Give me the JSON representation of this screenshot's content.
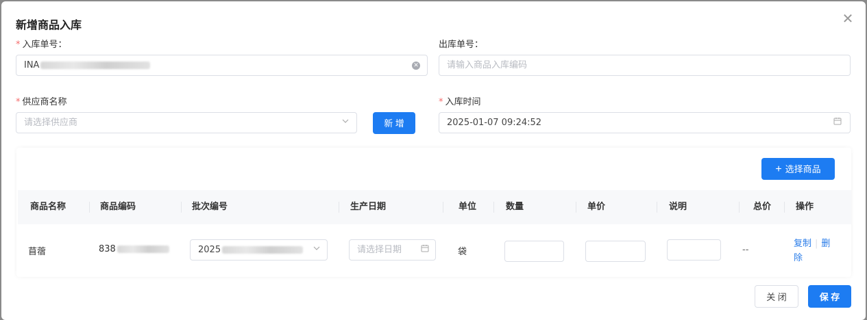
{
  "dialog": {
    "title": "新增商品入库",
    "close_icon": "close-icon"
  },
  "form": {
    "inbound_no": {
      "label": "入库单号：",
      "required": true,
      "value_prefix": "INA"
    },
    "outbound_no": {
      "label": "出库单号：",
      "placeholder": "请输入商品入库编码"
    },
    "supplier": {
      "label": "供应商名称",
      "required": true,
      "placeholder": "请选择供应商"
    },
    "add_supplier_label": "新 增",
    "inbound_time": {
      "label": "入库时间",
      "required": true,
      "value": "2025-01-07 09:24:52"
    }
  },
  "table": {
    "select_goods_label": "选择商品",
    "headers": [
      "商品名称",
      "商品编码",
      "批次编号",
      "生产日期",
      "单位",
      "数量",
      "单价",
      "说明",
      "总价",
      "操作"
    ],
    "rows": [
      {
        "name": "苜蓿",
        "code_prefix": "838",
        "batch_prefix": "2025",
        "date_placeholder": "请选择日期",
        "unit": "袋",
        "total": "--",
        "action_copy": "复制",
        "action_delete": "删除"
      }
    ]
  },
  "footer": {
    "close_label": "关 闭",
    "save_label": "保 存"
  },
  "colors": {
    "primary": "#1d7cf2",
    "required": "#f56c6c",
    "link": "#2b7de9"
  }
}
